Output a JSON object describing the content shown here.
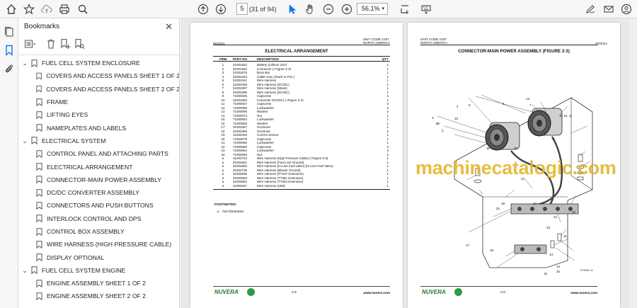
{
  "toolbar": {
    "page_current": "5",
    "page_count": "(31 of 94)",
    "zoom": "56,1%"
  },
  "bookmarks": {
    "title": "Bookmarks",
    "items": [
      {
        "label": "FUEL CELL SYSTEM ENCLOSURE",
        "level": 0
      },
      {
        "label": "COVERS AND ACCESS PANELS SHEET 1 OF 2",
        "level": 1
      },
      {
        "label": "COVERS AND ACCESS PANELS SHEET 2 OF 2",
        "level": 1
      },
      {
        "label": "FRAME",
        "level": 1
      },
      {
        "label": "LIFTING EYES",
        "level": 1
      },
      {
        "label": "NAMEPLATES AND LABELS",
        "level": 1
      },
      {
        "label": "ELECTRICAL SYSTEM",
        "level": 0
      },
      {
        "label": "CONTROL PANEL AND ATTACHING PARTS",
        "level": 1
      },
      {
        "label": "ELECTRICAL ARRANGEMENT",
        "level": 1
      },
      {
        "label": "CONNECTOR-MAIN POWER ASSEMBLY",
        "level": 1
      },
      {
        "label": "DC/DC CONVERTER ASSEMBLY",
        "level": 1
      },
      {
        "label": "CONNECTORS AND PUSH BUTTONS",
        "level": 1
      },
      {
        "label": "INTERLOCK CONTROL AND DPS",
        "level": 1
      },
      {
        "label": "CONTROL BOX ASSEMBLY",
        "level": 1
      },
      {
        "label": "WIRE HARNESS (HIGH PRESSURE CABLE)",
        "level": 1
      },
      {
        "label": "DISPLAY OPTIONAL",
        "level": 1
      },
      {
        "label": "FUEL CELL SYSTEM ENGINE",
        "level": 0
      },
      {
        "label": "ENGINE ASSEMBLY SHEET 1 OF 2",
        "level": 1
      },
      {
        "label": "ENGINE ASSEMBLY SHEET 2 OF 2",
        "level": 1
      }
    ]
  },
  "left_page": {
    "date": "05/2021",
    "unit_code": "UNIT CODE A207",
    "region": "NORTH AMERICA",
    "title": "ELECTRICAL ARRANGEMENT",
    "col_item": "ITEM",
    "col_part": "PART NO.",
    "col_desc": "DESCRIPTION",
    "col_qty": "QTY",
    "rows": [
      {
        "item": "1",
        "part": "31002302",
        "desc": "Battery (Lithium 24V)",
        "qty": "1"
      },
      {
        "item": "2",
        "part": "31001640",
        "desc": "Connector  (+Figure 2-3)",
        "qty": "1"
      },
      {
        "item": "3",
        "part": "31001676",
        "desc": "Buss Bar",
        "qty": "1"
      },
      {
        "item": "4",
        "part": "31003443",
        "desc": "Cable Assy (Stack to Pos.)",
        "qty": "1"
      },
      {
        "item": "5",
        "part": "31002341",
        "desc": "Wire Harness",
        "qty": "1"
      },
      {
        "item": "6",
        "part": "31002405",
        "desc": "Wire Harness (DC/DC)",
        "qty": "1"
      },
      {
        "item": "7",
        "part": "31002397",
        "desc": "Wire Harness (Stack)",
        "qty": "1"
      },
      {
        "item": "8",
        "part": "31002398",
        "desc": "Wire Harness (DC/DC)",
        "qty": "1"
      },
      {
        "item": "9",
        "part": "71000006",
        "desc": "Capscrew",
        "qty": "4"
      },
      {
        "item": "10",
        "part": "31001650",
        "desc": "Converter (DC/DC)  (+Figure 2-4)",
        "qty": "1"
      },
      {
        "item": "11",
        "part": "71000037",
        "desc": "Capscrew",
        "qty": "2"
      },
      {
        "item": "12",
        "part": "71000085",
        "desc": "Lockwasher",
        "qty": "2"
      },
      {
        "item": "13",
        "part": "71000059",
        "desc": "Washer",
        "qty": "2"
      },
      {
        "item": "14",
        "part": "71000072",
        "desc": "Nut",
        "qty": "1"
      },
      {
        "item": "15",
        "part": "71000054",
        "desc": "Lockwasher",
        "qty": "1"
      },
      {
        "item": "16",
        "part": "71000058",
        "desc": "Washer",
        "qty": "1"
      },
      {
        "item": "17",
        "part": "31002357",
        "desc": "Grommet",
        "qty": "1"
      },
      {
        "item": "18",
        "part": "31002356",
        "desc": "Grommet",
        "qty": "2"
      },
      {
        "item": "19",
        "part": "31000403",
        "desc": "Current Sensor",
        "qty": "1"
      },
      {
        "item": "20",
        "part": "71000079",
        "desc": "Capscrew",
        "qty": "1"
      },
      {
        "item": "21",
        "part": "71000086",
        "desc": "Lockwasher",
        "qty": "1"
      },
      {
        "item": "22",
        "part": "71000056",
        "desc": "Capscrew",
        "qty": "2"
      },
      {
        "item": "23",
        "part": "71000054",
        "desc": "Lockwasher",
        "qty": "2"
      },
      {
        "item": "24",
        "part": "71000060",
        "desc": "Nut",
        "qty": "2"
      },
      {
        "item": "a",
        "part": "31003742",
        "desc": "Wire Harness (High Pressure Cable)  (+Figure 2-8)",
        "qty": "1"
      },
      {
        "item": "a",
        "part": "31004651",
        "desc": "Wire Harness (Fuel Line Ground)",
        "qty": "1"
      },
      {
        "item": "a",
        "part": "31004650",
        "desc": "Wire Harness (In-Line Fuel Valve) (In-Line Fuel Valve)",
        "qty": "1"
      },
      {
        "item": "a",
        "part": "31004726",
        "desc": "Wire Harness (Blower Ground)",
        "qty": "1"
      },
      {
        "item": "a",
        "part": "31003635",
        "desc": "Wire Harness (PT157 Extension)",
        "qty": "1"
      },
      {
        "item": "a",
        "part": "31003655",
        "desc": "Wire Harness (TT351 Extension)",
        "qty": "1"
      },
      {
        "item": "a",
        "part": "31003654",
        "desc": "Wire Harness (TT304 Extension)",
        "qty": "1"
      },
      {
        "item": "a",
        "part": "31006267",
        "desc": "Wire Harness (HMI)",
        "qty": "1"
      }
    ],
    "footnotes_title": "FOOTNOTES:",
    "footnote_a_mark": "a",
    "footnote_a_text": "Not Illustrated",
    "brand": "NUVERA",
    "page_num": "2-5",
    "website": "www.nuvera.com"
  },
  "right_page": {
    "date": "05/2021",
    "unit_code": "UNIT CODE A207",
    "region": "NORTH AMERICA",
    "title": "CONNECTOR-MAIN POWER ASSEMBLY (FIGURE 2-3)",
    "callouts": [
      "1",
      "2",
      "3",
      "4",
      "5",
      "6",
      "7",
      "8, 10, 11",
      "9",
      "10",
      "11",
      "12",
      "13",
      "13",
      "14",
      "14",
      "15",
      "15",
      "16",
      "17",
      "18",
      "19",
      "20",
      "21",
      "22",
      "23",
      "24",
      "25"
    ],
    "figure_id": "EP9661 04",
    "brand": "NUVERA",
    "page_num": "2-6",
    "website": "www.nuvera.com"
  },
  "watermark": "machinecatalogic.com",
  "colors": {
    "brand_green": "#1f7a3a",
    "watermark": "#e2b428",
    "active_rail": "#1a73e8"
  }
}
